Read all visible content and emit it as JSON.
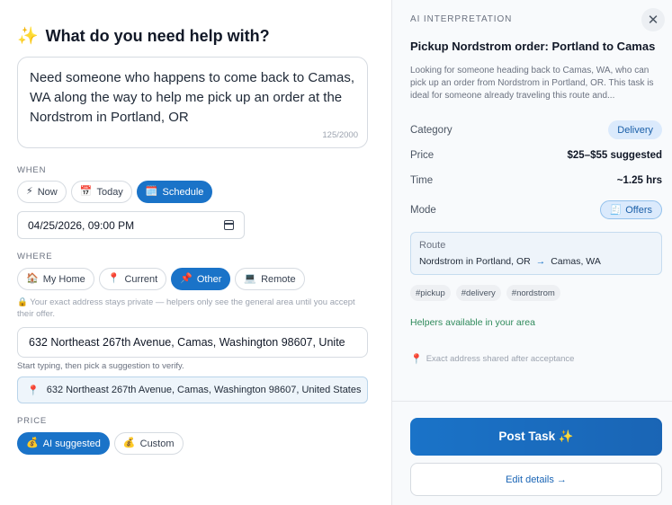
{
  "form": {
    "heading": "What do you need help with?",
    "heading_icon": "sparkles-icon",
    "description": "Need someone who happens to come back to Camas, WA along the way to help me pick up an order at the Nordstrom in Portland, OR",
    "char_count": "125/2000",
    "when": {
      "label": "WHEN",
      "options": [
        {
          "icon": "⚡",
          "label": "Now",
          "active": false
        },
        {
          "icon": "📅",
          "label": "Today",
          "active": false
        },
        {
          "icon": "🗓️",
          "label": "Schedule",
          "active": true
        }
      ],
      "datetime": "04/25/2026, 09:00 PM"
    },
    "where": {
      "label": "WHERE",
      "options": [
        {
          "icon": "🏠",
          "label": "My Home",
          "active": false
        },
        {
          "icon": "📍",
          "label": "Current",
          "active": false
        },
        {
          "icon": "📌",
          "label": "Other",
          "active": true
        },
        {
          "icon": "💻",
          "label": "Remote",
          "active": false
        }
      ],
      "privacy_note": "🔒 Your exact address stays private — helpers only see the general area until you accept their offer.",
      "address_input": "632 Northeast 267th Avenue, Camas, Washington 98607, Unite",
      "hint": "Start typing, then pick a suggestion to verify.",
      "verified_address": "632 Northeast 267th Avenue, Camas, Washington 98607, United States"
    },
    "price": {
      "label": "PRICE",
      "options": [
        {
          "icon": "💰",
          "label": "AI suggested",
          "active": true
        },
        {
          "icon": "💰",
          "label": "Custom",
          "active": false
        }
      ]
    }
  },
  "ai": {
    "section_label": "AI INTERPRETATION",
    "close_symbol": "✕",
    "title": "Pickup Nordstrom order: Portland to Camas",
    "description": "Looking for someone heading back to Camas, WA, who can pick up an order from Nordstrom in Portland, OR. This task is ideal for someone already traveling this route and...",
    "category_label": "Category",
    "category_value": "Delivery",
    "price_label": "Price",
    "price_value": "$25–$55 suggested",
    "time_label": "Time",
    "time_value": "~1.25 hrs",
    "mode_label": "Mode",
    "mode_icon": "🧾",
    "mode_value": "Offers",
    "route_label": "Route",
    "route_from": "Nordstrom in Portland, OR",
    "route_arrow": "→",
    "route_to": "Camas, WA",
    "tags": [
      "#pickup",
      "#delivery",
      "#nordstrom"
    ],
    "availability": "Helpers available in your area",
    "exact_note": "Exact address shared after acceptance",
    "post_label": "Post Task ✨",
    "edit_label": "Edit details →"
  },
  "colors": {
    "accent": "#1a73c8",
    "availability": "#2f8a5b"
  }
}
